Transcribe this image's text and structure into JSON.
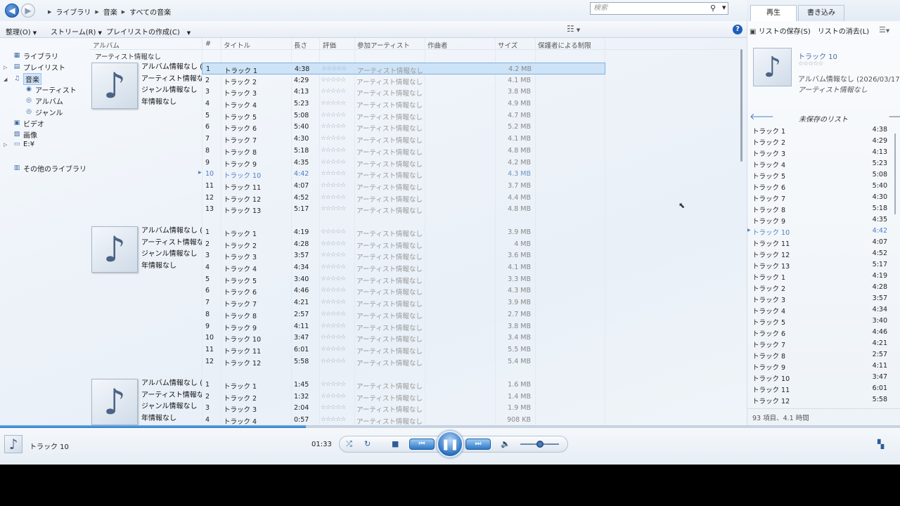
{
  "nav": {
    "breadcrumb": [
      "ライブラリ",
      "音楽",
      "すべての音楽"
    ]
  },
  "toolbar": {
    "organize": "整理(O)",
    "stream": "ストリーム(R)",
    "create_playlist": "プレイリストの作成(C)",
    "search_placeholder": "検索",
    "help": "?"
  },
  "right_tabs": {
    "play": "再生",
    "burn": "書き込み"
  },
  "sidebar": {
    "library": "ライブラリ",
    "playlists": "プレイリスト",
    "music": "音楽",
    "artist": "アーティスト",
    "album": "アルバム",
    "genre": "ジャンル",
    "video": "ビデオ",
    "pictures": "画像",
    "drive": "E:¥",
    "other_libraries": "その他のライブラリ"
  },
  "columns": {
    "album": "アルバム",
    "num": "#",
    "title": "タイトル",
    "length": "長さ",
    "rating": "評価",
    "artist": "参加アーティスト",
    "composer": "作曲者",
    "size": "サイズ",
    "parental": "保護者による制限"
  },
  "group_header": "アーティスト情報なし",
  "album_info": {
    "album": "アルバム情報なし (...",
    "artist": "アーティスト情報なし",
    "genre": "ジャンル情報なし",
    "year": "年情報なし"
  },
  "rating_stars": "☆☆☆☆☆",
  "artist_unknown": "アーティスト情報なし",
  "albums": [
    {
      "tracks": [
        {
          "n": "1",
          "t": "トラック 1",
          "l": "4:38",
          "s": "4.2 MB"
        },
        {
          "n": "2",
          "t": "トラック 2",
          "l": "4:29",
          "s": "4.1 MB"
        },
        {
          "n": "3",
          "t": "トラック 3",
          "l": "4:13",
          "s": "3.8 MB"
        },
        {
          "n": "4",
          "t": "トラック 4",
          "l": "5:23",
          "s": "4.9 MB"
        },
        {
          "n": "5",
          "t": "トラック 5",
          "l": "5:08",
          "s": "4.7 MB"
        },
        {
          "n": "6",
          "t": "トラック 6",
          "l": "5:40",
          "s": "5.2 MB"
        },
        {
          "n": "7",
          "t": "トラック 7",
          "l": "4:30",
          "s": "4.1 MB"
        },
        {
          "n": "8",
          "t": "トラック 8",
          "l": "5:18",
          "s": "4.8 MB"
        },
        {
          "n": "9",
          "t": "トラック 9",
          "l": "4:35",
          "s": "4.2 MB"
        },
        {
          "n": "10",
          "t": "トラック 10",
          "l": "4:42",
          "s": "4.3 MB"
        },
        {
          "n": "11",
          "t": "トラック 11",
          "l": "4:07",
          "s": "3.7 MB"
        },
        {
          "n": "12",
          "t": "トラック 12",
          "l": "4:52",
          "s": "4.4 MB"
        },
        {
          "n": "13",
          "t": "トラック 13",
          "l": "5:17",
          "s": "4.8 MB"
        }
      ]
    },
    {
      "tracks": [
        {
          "n": "1",
          "t": "トラック 1",
          "l": "4:19",
          "s": "3.9 MB"
        },
        {
          "n": "2",
          "t": "トラック 2",
          "l": "4:28",
          "s": "4 MB"
        },
        {
          "n": "3",
          "t": "トラック 3",
          "l": "3:57",
          "s": "3.6 MB"
        },
        {
          "n": "4",
          "t": "トラック 4",
          "l": "4:34",
          "s": "4.1 MB"
        },
        {
          "n": "5",
          "t": "トラック 5",
          "l": "3:40",
          "s": "3.3 MB"
        },
        {
          "n": "6",
          "t": "トラック 6",
          "l": "4:46",
          "s": "4.3 MB"
        },
        {
          "n": "7",
          "t": "トラック 7",
          "l": "4:21",
          "s": "3.9 MB"
        },
        {
          "n": "8",
          "t": "トラック 8",
          "l": "2:57",
          "s": "2.7 MB"
        },
        {
          "n": "9",
          "t": "トラック 9",
          "l": "4:11",
          "s": "3.8 MB"
        },
        {
          "n": "10",
          "t": "トラック 10",
          "l": "3:47",
          "s": "3.4 MB"
        },
        {
          "n": "11",
          "t": "トラック 11",
          "l": "6:01",
          "s": "5.5 MB"
        },
        {
          "n": "12",
          "t": "トラック 12",
          "l": "5:58",
          "s": "5.4 MB"
        }
      ]
    },
    {
      "tracks": [
        {
          "n": "1",
          "t": "トラック 1",
          "l": "1:45",
          "s": "1.6 MB"
        },
        {
          "n": "2",
          "t": "トラック 2",
          "l": "1:32",
          "s": "1.4 MB"
        },
        {
          "n": "3",
          "t": "トラック 3",
          "l": "2:04",
          "s": "1.9 MB"
        },
        {
          "n": "4",
          "t": "トラック 4",
          "l": "0:57",
          "s": "908 KB"
        }
      ]
    }
  ],
  "right_panel": {
    "save_list": "リストの保存(S)",
    "clear_list": "リストの消去(L)",
    "now_title": "トラック 10",
    "now_album": "アルバム情報なし (2026/03/17 21:...",
    "now_artist": "アーティスト情報なし",
    "list_title": "未保存のリスト",
    "playlist": [
      {
        "t": "トラック 1",
        "d": "4:38"
      },
      {
        "t": "トラック 2",
        "d": "4:29"
      },
      {
        "t": "トラック 3",
        "d": "4:13"
      },
      {
        "t": "トラック 4",
        "d": "5:23"
      },
      {
        "t": "トラック 5",
        "d": "5:08"
      },
      {
        "t": "トラック 6",
        "d": "5:40"
      },
      {
        "t": "トラック 7",
        "d": "4:30"
      },
      {
        "t": "トラック 8",
        "d": "5:18"
      },
      {
        "t": "トラック 9",
        "d": "4:35"
      },
      {
        "t": "トラック 10",
        "d": "4:42"
      },
      {
        "t": "トラック 11",
        "d": "4:07"
      },
      {
        "t": "トラック 12",
        "d": "4:52"
      },
      {
        "t": "トラック 13",
        "d": "5:17"
      },
      {
        "t": "トラック 1",
        "d": "4:19"
      },
      {
        "t": "トラック 2",
        "d": "4:28"
      },
      {
        "t": "トラック 3",
        "d": "3:57"
      },
      {
        "t": "トラック 4",
        "d": "4:34"
      },
      {
        "t": "トラック 5",
        "d": "3:40"
      },
      {
        "t": "トラック 6",
        "d": "4:46"
      },
      {
        "t": "トラック 7",
        "d": "4:21"
      },
      {
        "t": "トラック 8",
        "d": "2:57"
      },
      {
        "t": "トラック 9",
        "d": "4:11"
      },
      {
        "t": "トラック 10",
        "d": "3:47"
      },
      {
        "t": "トラック 11",
        "d": "6:01"
      },
      {
        "t": "トラック 12",
        "d": "5:58"
      }
    ],
    "footer": "93 項目、4.1 時間"
  },
  "player": {
    "title": "トラック 10",
    "elapsed": "01:33",
    "progress_fraction": 0.34,
    "volume_fraction": 0.5
  },
  "icons": {
    "back": "back-arrow-icon",
    "forward": "forward-arrow-icon",
    "note": "music-note-icon",
    "search": "search-icon",
    "shuffle": "shuffle-icon",
    "repeat": "repeat-icon",
    "stop": "stop-icon",
    "prev": "previous-icon",
    "play_pause": "pause-icon",
    "next": "next-icon",
    "volume": "speaker-icon"
  },
  "colors": {
    "accent": "#2b77c7",
    "selection": "#cde3f7",
    "playing": "#4a7fc4"
  }
}
